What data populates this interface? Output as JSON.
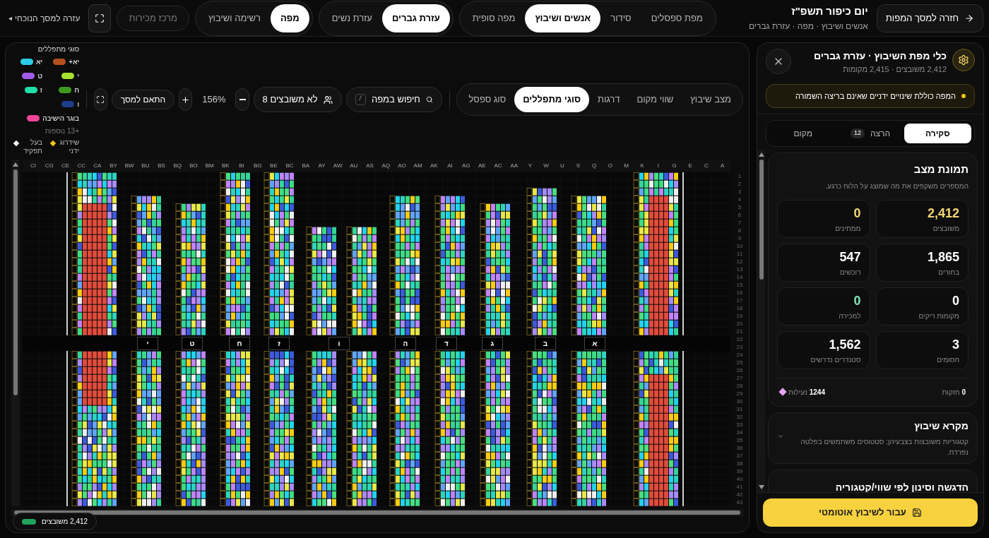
{
  "topbar": {
    "back_button": "חזרה למסך המפות",
    "title": "יום כיפור תשפ\"ז",
    "subtitle": "אנשים ושיבוץ · מפה · עזרת גברים",
    "view_tabs": [
      {
        "label": "מפת ספסלים",
        "selected": false
      },
      {
        "label": "סידור",
        "selected": false
      },
      {
        "label": "אנשים ושיבוץ",
        "selected": true
      },
      {
        "label": "מפה סופית",
        "selected": false
      }
    ],
    "section_tabs": [
      {
        "label": "עזרת גברים",
        "selected": true
      },
      {
        "label": "עזרת נשים",
        "selected": false
      }
    ],
    "mode_tabs": [
      {
        "label": "מפה",
        "selected": true
      },
      {
        "label": "רשימה ושיבוץ",
        "selected": false
      }
    ],
    "sales_button": {
      "label": "מרכז מכירות",
      "disabled": true
    },
    "help_link": {
      "icon": "◂",
      "label": "עזרה למסך הנוכחי"
    }
  },
  "map": {
    "layer_tabs": [
      {
        "label": "מצב שיבוץ",
        "selected": false
      },
      {
        "label": "שווי מקום",
        "selected": false
      },
      {
        "label": "דרגות",
        "selected": false
      },
      {
        "label": "סוגי מתפללים",
        "selected": true
      },
      {
        "label": "סוג ספסל",
        "selected": false
      }
    ],
    "search": {
      "label": "חיפוש במפה",
      "shortcut": "/"
    },
    "unassigned": {
      "label": "לא משובצים",
      "count": "8"
    },
    "zoom": "156%",
    "fit_button": "התאם למסך",
    "legend": {
      "title": "סוגי מתפללים",
      "items": [
        {
          "label": "יא+",
          "color": "#b4501e"
        },
        {
          "label": "יא",
          "color": "#2ccbe8"
        },
        {
          "label": "י",
          "color": "#a6e22e"
        },
        {
          "label": "ט",
          "color": "#a25be8"
        },
        {
          "label": "ח",
          "color": "#3c9a1e"
        },
        {
          "label": "ז",
          "color": "#1ee0a8"
        },
        {
          "label": "ו",
          "color": "#1e3c8c"
        },
        {
          "label": "בוגר הישיבה",
          "color": "#f0459b"
        }
      ],
      "more": "+13 נוספות",
      "markers": [
        {
          "label": "שידרוג ידני",
          "color": "#f5c518"
        },
        {
          "label": "בעל תפקיד",
          "color": "#ffffff"
        }
      ]
    },
    "columns": [
      "A",
      "C",
      "E",
      "G",
      "I",
      "K",
      "M",
      "O",
      "Q",
      "S",
      "U",
      "W",
      "Y",
      "AA",
      "AC",
      "AE",
      "AG",
      "AI",
      "AK",
      "AM",
      "AO",
      "AQ",
      "AS",
      "AU",
      "AW",
      "AY",
      "BA",
      "BC",
      "BE",
      "BG",
      "BI",
      "BK",
      "BM",
      "BO",
      "BQ",
      "BS",
      "BU",
      "BW",
      "BY",
      "CA",
      "CC",
      "CE",
      "CG",
      "CI"
    ],
    "rows": [
      "1",
      "2",
      "3",
      "4",
      "5",
      "6",
      "7",
      "8",
      "9",
      "10",
      "11",
      "12",
      "13",
      "14",
      "15",
      "16",
      "17",
      "18",
      "19",
      "20",
      "21",
      "22",
      "23",
      "24",
      "25",
      "26",
      "27",
      "28",
      "29",
      "30",
      "31",
      "32",
      "33",
      "34",
      "35",
      "36",
      "37",
      "38",
      "39",
      "40",
      "41",
      "42",
      "43"
    ],
    "sections": [
      "א",
      "ב",
      "ג",
      "ד",
      "ה",
      "ו",
      "ז",
      "ח",
      "ט",
      "י"
    ],
    "assigned_badge": "2,412 משובצים"
  },
  "panel": {
    "title": "כלי מפת השיבוץ · עזרת גברים",
    "subtitle": "2,412 משובצים · 2,415 מקומות",
    "alert": "המפה כוללת שינויים ידניים שאינם בריצה השמורה",
    "tabs": [
      {
        "label": "סקירה",
        "selected": true
      },
      {
        "label": "הרצה",
        "badge": "12",
        "selected": false
      },
      {
        "label": "מקום",
        "selected": false
      }
    ],
    "snapshot": {
      "title": "תמונת מצב",
      "description": "המספרים משקפים את מה שמוצג על הלוח כרגע.",
      "stats": [
        {
          "value": "2,412",
          "label": "משובצים",
          "color": "#f3d774"
        },
        {
          "value": "0",
          "label": "ממתינים",
          "color": "#f3d774"
        },
        {
          "value": "1,865",
          "label": "בחורים",
          "color": "#ffffff"
        },
        {
          "value": "547",
          "label": "רוכשים",
          "color": "#ffffff"
        },
        {
          "value": "0",
          "label": "מקומות ריקים",
          "color": "#ffffff"
        },
        {
          "value": "0",
          "label": "למכירה",
          "color": "#7ee8b5"
        },
        {
          "value": "3",
          "label": "חסומים",
          "color": "#ffffff"
        },
        {
          "value": "1,562",
          "label": "סטנדרים נדרשים",
          "color": "#ffffff"
        }
      ],
      "holdings": {
        "value": "0",
        "label": "חזקות"
      },
      "locks": {
        "value": "1244",
        "label": "נעילות"
      }
    },
    "legend_card": {
      "title": "מקרא שיבוץ",
      "description": "קטגוריות משובצות בצבעיהן; סטטוסים משתמשים בפלטה נפרדת."
    },
    "filter_card": {
      "title": "הדגשה וסינון לפי שווי/קטגוריה"
    },
    "auto_button": "עבור לשיבוץ אוטומטי"
  }
}
